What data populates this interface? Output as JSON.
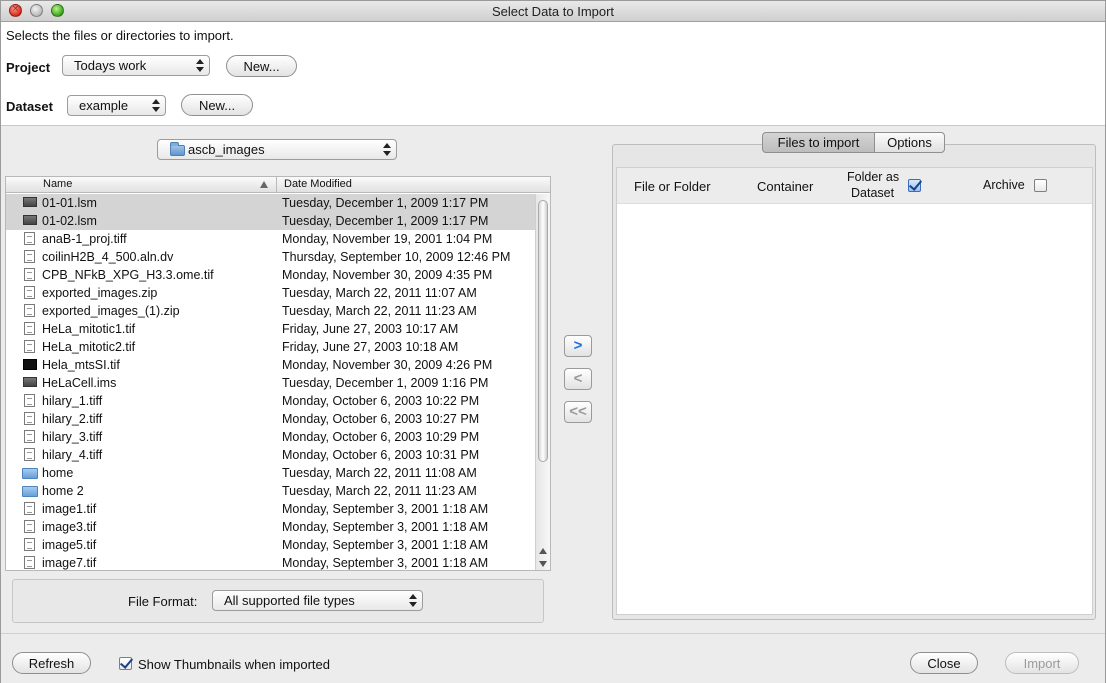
{
  "window": {
    "title": "Select Data to Import"
  },
  "header": {
    "description": "Selects the files or directories to import.",
    "project_label": "Project",
    "project_value": "Todays work",
    "project_new": "New...",
    "dataset_label": "Dataset",
    "dataset_value": "example",
    "dataset_new": "New..."
  },
  "chooser": {
    "folder": "ascb_images",
    "columns": {
      "name": "Name",
      "date": "Date Modified"
    },
    "files": [
      {
        "name": "01-01.lsm",
        "date": "Tuesday, December 1, 2009 1:17 PM",
        "icon": "dark-file-icon",
        "selected": true
      },
      {
        "name": "01-02.lsm",
        "date": "Tuesday, December 1, 2009 1:17 PM",
        "icon": "dark-file-icon",
        "selected": true
      },
      {
        "name": "anaB-1_proj.tiff",
        "date": "Monday, November 19, 2001 1:04 PM",
        "icon": "document-icon"
      },
      {
        "name": "coilinH2B_4_500.aln.dv",
        "date": "Thursday, September 10, 2009 12:46 PM",
        "icon": "document-icon"
      },
      {
        "name": "CPB_NFkB_XPG_H3.3.ome.tif",
        "date": "Monday, November 30, 2009 4:35 PM",
        "icon": "document-icon"
      },
      {
        "name": "exported_images.zip",
        "date": "Tuesday, March 22, 2011 11:07 AM",
        "icon": "document-icon"
      },
      {
        "name": "exported_images_(1).zip",
        "date": "Tuesday, March 22, 2011 11:23 AM",
        "icon": "document-icon"
      },
      {
        "name": "HeLa_mitotic1.tif",
        "date": "Friday, June 27, 2003 10:17 AM",
        "icon": "document-icon"
      },
      {
        "name": "HeLa_mitotic2.tif",
        "date": "Friday, June 27, 2003 10:18 AM",
        "icon": "document-icon"
      },
      {
        "name": "Hela_mtsSI.tif",
        "date": "Monday, November 30, 2009 4:26 PM",
        "icon": "film-icon"
      },
      {
        "name": "HeLaCell.ims",
        "date": "Tuesday, December 1, 2009 1:16 PM",
        "icon": "dark-file-icon"
      },
      {
        "name": "hilary_1.tiff",
        "date": "Monday, October 6, 2003 10:22 PM",
        "icon": "document-icon"
      },
      {
        "name": "hilary_2.tiff",
        "date": "Monday, October 6, 2003 10:27 PM",
        "icon": "document-icon"
      },
      {
        "name": "hilary_3.tiff",
        "date": "Monday, October 6, 2003 10:29 PM",
        "icon": "document-icon"
      },
      {
        "name": "hilary_4.tiff",
        "date": "Monday, October 6, 2003 10:31 PM",
        "icon": "document-icon"
      },
      {
        "name": "home",
        "date": "Tuesday, March 22, 2011 11:08 AM",
        "icon": "folder-icon"
      },
      {
        "name": "home 2",
        "date": "Tuesday, March 22, 2011 11:23 AM",
        "icon": "folder-icon"
      },
      {
        "name": "image1.tif",
        "date": "Monday, September 3, 2001 1:18 AM",
        "icon": "document-icon"
      },
      {
        "name": "image3.tif",
        "date": "Monday, September 3, 2001 1:18 AM",
        "icon": "document-icon"
      },
      {
        "name": "image5.tif",
        "date": "Monday, September 3, 2001 1:18 AM",
        "icon": "document-icon"
      },
      {
        "name": "image7.tif",
        "date": "Monday, September 3, 2001 1:18 AM",
        "icon": "document-icon"
      }
    ],
    "format_label": "File Format:",
    "format_value": "All supported file types"
  },
  "transfer": {
    "add": ">",
    "remove": "<",
    "remove_all": "<<"
  },
  "import_panel": {
    "tabs": {
      "files": "Files to import",
      "options": "Options"
    },
    "columns": {
      "file_or_folder": "File or Folder",
      "container": "Container",
      "folder_as_dataset_line1": "Folder as",
      "folder_as_dataset_line2": "Dataset",
      "archive": "Archive"
    },
    "folder_as_dataset_checked": true,
    "archive_checked": false
  },
  "footer": {
    "refresh": "Refresh",
    "show_thumbnails": "Show Thumbnails when imported",
    "show_thumbnails_checked": true,
    "close": "Close",
    "import": "Import"
  },
  "colors": {
    "selection": "#d4d4d4",
    "accent_blue": "#1f6fd6"
  }
}
